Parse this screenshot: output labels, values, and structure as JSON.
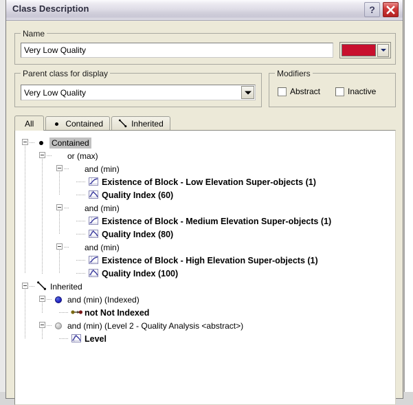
{
  "window": {
    "title": "Class Description",
    "help_button_label": "?",
    "close_button_label": "Close"
  },
  "name_group": {
    "legend": "Name",
    "value": "Very Low Quality",
    "placeholder": "",
    "color": "#c8102e",
    "color_dropdown_label": "Select color"
  },
  "parent_group": {
    "legend": "Parent class for display",
    "selected": "Very Low Quality"
  },
  "modifiers_group": {
    "legend": "Modifiers",
    "abstract_label": "Abstract",
    "abstract_checked": false,
    "inactive_label": "Inactive",
    "inactive_checked": false
  },
  "tabs": [
    {
      "label": "All",
      "icon": "",
      "active": true
    },
    {
      "label": "Contained",
      "icon": "dot-icon",
      "active": false
    },
    {
      "label": "Inherited",
      "icon": "arrow-icon",
      "active": false
    }
  ],
  "tree": {
    "nodes": [
      {
        "label": "Contained",
        "icon": "bullet-icon",
        "depth": 0,
        "expander": true,
        "bold": false,
        "selected": true
      },
      {
        "label": "or (max)",
        "icon": "none",
        "depth": 1,
        "expander": true,
        "bold": false,
        "selected": false
      },
      {
        "label": "and (min)",
        "icon": "none",
        "depth": 2,
        "expander": true,
        "bold": false,
        "selected": false
      },
      {
        "label": "Existence of Block - Low Elevation Super-objects  (1)",
        "icon": "scurve-icon",
        "depth": 3,
        "expander": false,
        "bold": true,
        "selected": false
      },
      {
        "label": "Quality Index (60)",
        "icon": "bell-icon",
        "depth": 3,
        "expander": false,
        "bold": true,
        "selected": false
      },
      {
        "label": "and (min)",
        "icon": "none",
        "depth": 2,
        "expander": true,
        "bold": false,
        "selected": false
      },
      {
        "label": "Existence of Block - Medium Elevation Super-objects  (1)",
        "icon": "scurve-icon",
        "depth": 3,
        "expander": false,
        "bold": true,
        "selected": false
      },
      {
        "label": "Quality Index (80)",
        "icon": "bell-icon",
        "depth": 3,
        "expander": false,
        "bold": true,
        "selected": false
      },
      {
        "label": "and (min)",
        "icon": "none",
        "depth": 2,
        "expander": true,
        "bold": false,
        "selected": false
      },
      {
        "label": "Existence of Block - High Elevation Super-objects  (1)",
        "icon": "scurve-icon",
        "depth": 3,
        "expander": false,
        "bold": true,
        "selected": false
      },
      {
        "label": "Quality Index (100)",
        "icon": "bell-icon",
        "depth": 3,
        "expander": false,
        "bold": true,
        "selected": false
      },
      {
        "label": "Inherited",
        "icon": "arrow-icon",
        "depth": 0,
        "expander": true,
        "bold": false,
        "selected": false
      },
      {
        "label": "and (min) (Indexed)",
        "icon": "circle-blue",
        "depth": 1,
        "expander": true,
        "bold": false,
        "selected": false
      },
      {
        "label": "not Not Indexed",
        "icon": "not-icon",
        "depth": 2,
        "expander": false,
        "bold": true,
        "selected": false
      },
      {
        "label": "and (min) (Level 2 - Quality Analysis <abstract>)",
        "icon": "circle-gray",
        "depth": 1,
        "expander": true,
        "bold": false,
        "selected": false
      },
      {
        "label": "Level",
        "icon": "bell-icon",
        "depth": 2,
        "expander": false,
        "bold": true,
        "selected": false
      }
    ]
  }
}
